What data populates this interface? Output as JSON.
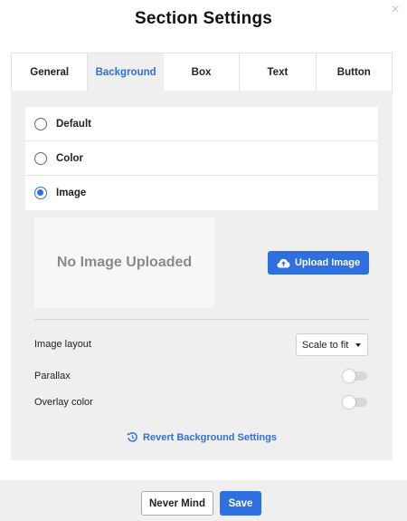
{
  "dialog": {
    "title": "Section Settings",
    "close_icon": "close-icon"
  },
  "tabs": [
    {
      "label": "General",
      "active": false
    },
    {
      "label": "Background",
      "active": true
    },
    {
      "label": "Box",
      "active": false
    },
    {
      "label": "Text",
      "active": false
    },
    {
      "label": "Button",
      "active": false
    }
  ],
  "background": {
    "options": [
      {
        "label": "Default",
        "checked": false
      },
      {
        "label": "Color",
        "checked": false
      },
      {
        "label": "Image",
        "checked": true
      }
    ],
    "image_placeholder": "No Image Uploaded",
    "upload_label": "Upload Image",
    "upload_icon": "cloud-upload-icon",
    "image_layout_label": "Image layout",
    "image_layout_value": "Scale to fit",
    "parallax_label": "Parallax",
    "parallax_on": false,
    "overlay_label": "Overlay color",
    "overlay_on": false,
    "revert_label": "Revert Background Settings",
    "revert_icon": "revert-icon"
  },
  "footer": {
    "cancel_label": "Never Mind",
    "save_label": "Save"
  },
  "colors": {
    "accent": "#2f6fe0",
    "panel_bg": "#efefef",
    "placeholder_text": "#8a8a8a"
  }
}
